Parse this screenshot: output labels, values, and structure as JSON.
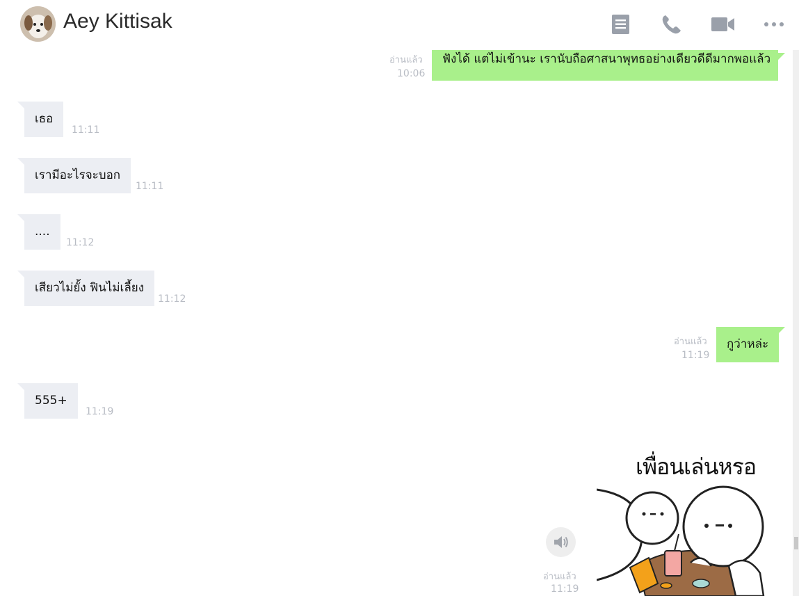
{
  "header": {
    "contact_name": "Aey Kittisak",
    "icons": [
      "notes-icon",
      "phone-icon",
      "video-call-icon",
      "more-icon"
    ]
  },
  "colors": {
    "incoming_bubble": "#eceef3",
    "outgoing_bubble": "#a9f08b",
    "meta_text": "#b8bcc4"
  },
  "messages": [
    {
      "direction": "out",
      "text": "ฟังได้ แต่ไม่เข้านะ เรานับถือศาสนาพุทธอย่างเดียวดีดีมากพอแล้ว",
      "read": "อ่านแล้ว",
      "time": "10:06"
    },
    {
      "direction": "in",
      "text": "เธอ",
      "time": "11:11"
    },
    {
      "direction": "in",
      "text": "เรามีอะไรจะบอก",
      "time": "11:11"
    },
    {
      "direction": "in",
      "text": "....",
      "time": "11:12"
    },
    {
      "direction": "in",
      "text": "เสียวไม่ยั้ง ฟินไม่เลี้ยง",
      "time": "11:12"
    },
    {
      "direction": "out",
      "text": "กูว่าหล่ะ",
      "read": "อ่านแล้ว",
      "time": "11:19"
    },
    {
      "direction": "in",
      "text": "555+",
      "time": "11:19"
    },
    {
      "direction": "out",
      "type": "sticker",
      "caption": "เพื่อนเล่นหรอ",
      "read": "อ่านแล้ว",
      "time": "11:19"
    }
  ]
}
